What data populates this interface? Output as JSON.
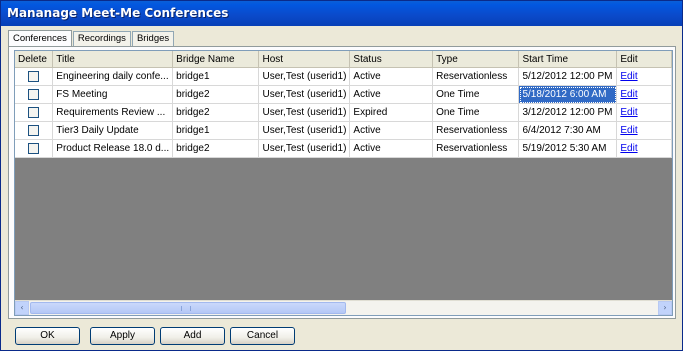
{
  "window": {
    "title": "Mananage Meet-Me Conferences"
  },
  "tabs": [
    {
      "label": "Conferences",
      "active": true
    },
    {
      "label": "Recordings",
      "active": false
    },
    {
      "label": "Bridges",
      "active": false
    }
  ],
  "grid": {
    "columns": [
      "Delete",
      "Title",
      "Bridge Name",
      "Host",
      "Status",
      "Type",
      "Start Time",
      "Edit"
    ],
    "rows": [
      {
        "delete": false,
        "title": "Engineering daily confe...",
        "bridge": "bridge1",
        "host": "User,Test (userid1)",
        "status": "Active",
        "type": "Reservationless",
        "start": "5/12/2012 12:00 PM",
        "edit": "Edit"
      },
      {
        "delete": false,
        "title": "FS Meeting",
        "bridge": "bridge2",
        "host": "User,Test (userid1)",
        "status": "Active",
        "type": "One Time",
        "start": "5/18/2012 6:00 AM",
        "edit": "Edit",
        "selected_cell": "start"
      },
      {
        "delete": false,
        "title": "Requirements Review ...",
        "bridge": "bridge2",
        "host": "User,Test (userid1)",
        "status": "Expired",
        "type": "One Time",
        "start": "3/12/2012 12:00 PM",
        "edit": "Edit"
      },
      {
        "delete": false,
        "title": "Tier3 Daily Update",
        "bridge": "bridge1",
        "host": "User,Test (userid1)",
        "status": "Active",
        "type": "Reservationless",
        "start": "6/4/2012 7:30 AM",
        "edit": "Edit"
      },
      {
        "delete": false,
        "title": "Product Release 18.0 d...",
        "bridge": "bridge2",
        "host": "User,Test (userid1)",
        "status": "Active",
        "type": "Reservationless",
        "start": "5/19/2012 5:30 AM",
        "edit": "Edit"
      }
    ],
    "link_color": "#0000ee",
    "selection_color": "#316ac5",
    "empty_area_color": "#808080"
  },
  "scrollbar": {
    "left_arrow": "‹",
    "right_arrow": "›"
  },
  "buttons": {
    "ok": "OK",
    "apply": "Apply",
    "add": "Add",
    "cancel": "Cancel"
  },
  "colors": {
    "titlebar": "#0a4bcc",
    "dialog": "#ece9d8"
  }
}
